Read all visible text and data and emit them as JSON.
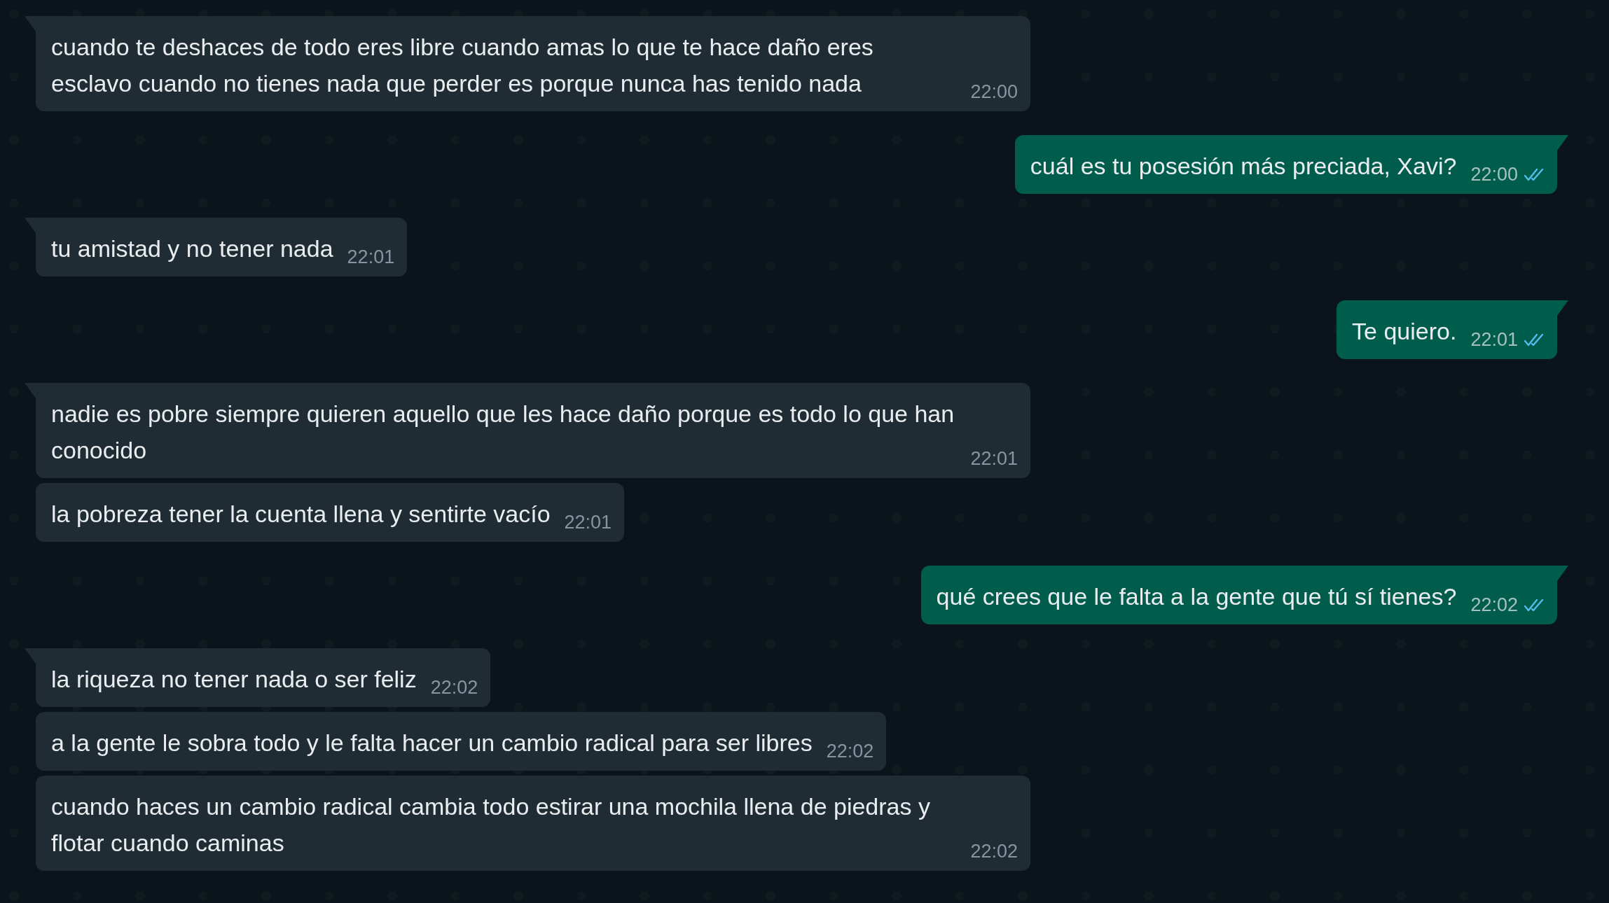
{
  "messages": [
    {
      "kind": "incoming",
      "tail": true,
      "text": "cuando te deshaces de todo eres libre cuando amas lo que te hace daño eres esclavo cuando no tienes nada que perder es porque nunca has tenido nada",
      "time": "22:00"
    },
    {
      "kind": "outgoing",
      "tail": true,
      "text": "cuál es tu posesión más preciada, Xavi?",
      "time": "22:00",
      "read": true
    },
    {
      "kind": "incoming",
      "tail": true,
      "text": "tu amistad y no tener nada",
      "time": "22:01"
    },
    {
      "kind": "outgoing",
      "tail": true,
      "text": "Te quiero.",
      "time": "22:01",
      "read": true
    },
    {
      "kind": "incoming",
      "tail": true,
      "text": "nadie es pobre siempre quieren aquello que les hace daño porque es todo lo que han conocido",
      "time": "22:01"
    },
    {
      "kind": "incoming",
      "tail": false,
      "text": "la pobreza tener la cuenta llena y sentirte vacío",
      "time": "22:01"
    },
    {
      "kind": "outgoing",
      "tail": true,
      "text": "qué crees que le falta a la gente que tú sí tienes?",
      "time": "22:02",
      "read": true
    },
    {
      "kind": "incoming",
      "tail": true,
      "text": "la riqueza no tener nada o ser feliz",
      "time": "22:02"
    },
    {
      "kind": "incoming",
      "tail": false,
      "text": "a la gente le sobra todo y le falta hacer un cambio radical para ser libres",
      "time": "22:02"
    },
    {
      "kind": "incoming",
      "tail": false,
      "text": "cuando haces un cambio radical cambia todo estirar una mochila llena de piedras y flotar cuando caminas",
      "time": "22:02"
    }
  ]
}
